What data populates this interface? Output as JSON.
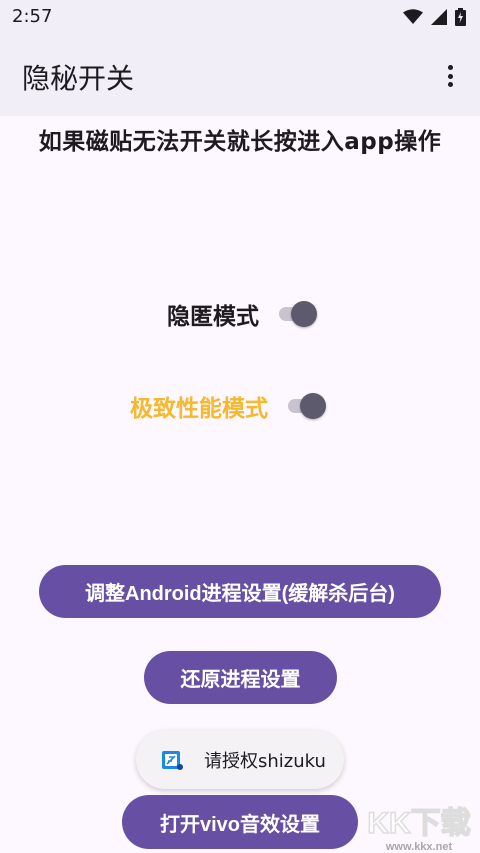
{
  "status_bar": {
    "time": "2:57"
  },
  "app_bar": {
    "title": "隐秘开关"
  },
  "headline": "如果磁贴无法开关就长按进入app操作",
  "toggles": [
    {
      "label": "隐匿模式",
      "on": true,
      "label_color": "#1d1b20"
    },
    {
      "label": "极致性能模式",
      "on": true,
      "label_color": "#f5b82e"
    }
  ],
  "buttons": {
    "adjust_process": "调整Android进程设置(缓解杀后台)",
    "restore_process": "还原进程设置",
    "open_vivo_audio": "打开vivo音效设置"
  },
  "toast": {
    "text": "请授权shizuku",
    "icon": "shizuku-icon"
  },
  "watermark": {
    "text": "KK下载",
    "url": "www.kkx.net"
  },
  "colors": {
    "primary": "#6750a4",
    "surface": "#fdf7ff",
    "app_bar": "#f2eef7",
    "accent_text": "#f5b82e"
  }
}
